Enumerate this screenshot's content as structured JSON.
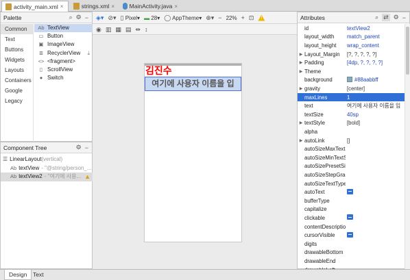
{
  "tabs": [
    {
      "label": "activity_main.xml",
      "active": true
    },
    {
      "label": "strings.xml",
      "active": false
    },
    {
      "label": "MainActivity.java",
      "active": false
    }
  ],
  "tab_close": "×",
  "palette": {
    "title": "Palette",
    "categories": [
      "Common",
      "Text",
      "Buttons",
      "Widgets",
      "Layouts",
      "Containers",
      "Google",
      "Legacy"
    ],
    "widgets": [
      {
        "icon": "Ab",
        "label": "TextView"
      },
      {
        "icon": "▭",
        "label": "Button"
      },
      {
        "icon": "▣",
        "label": "ImageView"
      },
      {
        "icon": "≣",
        "label": "RecyclerView"
      },
      {
        "icon": "<>",
        "label": "<fragment>"
      },
      {
        "icon": "▯",
        "label": "ScrollView"
      },
      {
        "icon": "●",
        "label": "Switch"
      }
    ]
  },
  "component_tree": {
    "title": "Component Tree",
    "root": {
      "label": "LinearLayout",
      "detail": "(vertical)"
    },
    "children": [
      {
        "icon": "Ab",
        "label": "textView",
        "detail": "- \"@string/person_..."
      },
      {
        "icon": "Ab",
        "label": "textView2",
        "detail": "- \"여기에 사용..."
      }
    ]
  },
  "toolbar": {
    "device": "Pixel",
    "api": "28",
    "theme": "AppTheme",
    "zoom": "22%",
    "zoom_out": "−",
    "zoom_in": "+",
    "zoom_fit": "⊡",
    "warning": "!"
  },
  "preview": {
    "text1": "김진수",
    "text2": "여기에 사용자 이름을 입"
  },
  "attributes": {
    "title": "Attributes",
    "rows": [
      {
        "name": "id",
        "value": "textView2",
        "expand": false
      },
      {
        "name": "layout_width",
        "value": "match_parent",
        "expand": false
      },
      {
        "name": "layout_height",
        "value": "wrap_content",
        "expand": false
      },
      {
        "name": "Layout_Margin",
        "value": "[?, ?, ?, ?, ?]",
        "expand": true
      },
      {
        "name": "Padding",
        "value": "[4dp, ?, ?, ?, ?]",
        "expand": true
      },
      {
        "name": "Theme",
        "value": "",
        "expand": true
      },
      {
        "name": "background",
        "value": "#88aabbff",
        "expand": false,
        "swatch": true
      },
      {
        "name": "gravity",
        "value": "[center]",
        "expand": true
      },
      {
        "name": "maxLines",
        "value": "1",
        "expand": false,
        "selected": true
      },
      {
        "name": "text",
        "value": "여기에 사용자 이름을 입",
        "expand": false
      },
      {
        "name": "textSize",
        "value": "40sp",
        "expand": false
      },
      {
        "name": "textStyle",
        "value": "[bold]",
        "expand": true
      },
      {
        "name": "alpha",
        "value": "",
        "expand": false
      },
      {
        "name": "autoLink",
        "value": "[]",
        "expand": true
      },
      {
        "name": "autoSizeMaxTextSize",
        "value": "",
        "expand": false
      },
      {
        "name": "autoSizeMinTextSize",
        "value": "",
        "expand": false
      },
      {
        "name": "autoSizePresetSizes",
        "value": "",
        "expand": false
      },
      {
        "name": "autoSizeStepGranularity",
        "value": "",
        "expand": false
      },
      {
        "name": "autoSizeTextType",
        "value": "",
        "expand": false
      },
      {
        "name": "autoText",
        "value": "",
        "expand": false,
        "toggle": true
      },
      {
        "name": "bufferType",
        "value": "",
        "expand": false
      },
      {
        "name": "capitalize",
        "value": "",
        "expand": false
      },
      {
        "name": "clickable",
        "value": "",
        "expand": false,
        "toggle": true
      },
      {
        "name": "contentDescription",
        "value": "",
        "expand": false
      },
      {
        "name": "cursorVisible",
        "value": "",
        "expand": false,
        "toggle": true
      },
      {
        "name": "digits",
        "value": "",
        "expand": false
      },
      {
        "name": "drawableBottom",
        "value": "",
        "expand": false
      },
      {
        "name": "drawableEnd",
        "value": "",
        "expand": false
      },
      {
        "name": "drawableLeft",
        "value": "",
        "expand": false
      }
    ]
  },
  "bottom_tabs": [
    "Design",
    "Text"
  ],
  "colors": {
    "accent": "#2f6fd6",
    "preview_title": "#ff0000",
    "preview_bg": "#88aabb"
  }
}
